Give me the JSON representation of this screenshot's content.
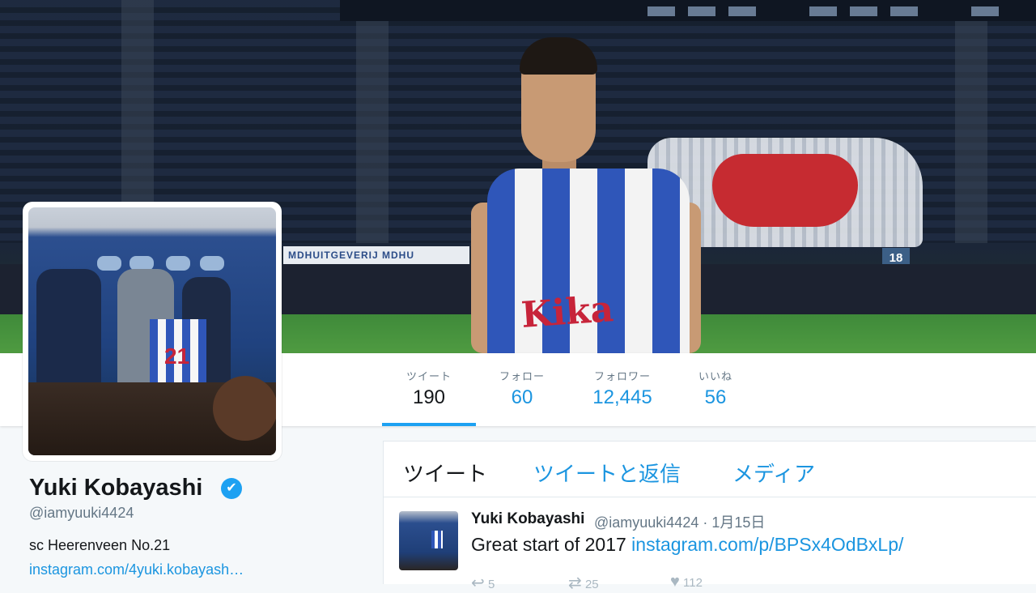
{
  "profile": {
    "name": "Yuki Kobayashi",
    "handle": "@iamyuuki4424",
    "bio": "sc Heerenveen No.21",
    "link": "instagram.com/4yuki.kobayash…",
    "verified_mark": "✔",
    "jersey_number": "21"
  },
  "banner": {
    "adboard_text": "MDHUITGEVERIJ   MDHU",
    "sign_number": "18",
    "shirt_sponsor": "Kika"
  },
  "stats": [
    {
      "label": "ツイート",
      "value": "190"
    },
    {
      "label": "フォロー",
      "value": "60"
    },
    {
      "label": "フォロワー",
      "value": "12,445"
    },
    {
      "label": "いいね",
      "value": "56"
    }
  ],
  "tabs": [
    {
      "label": "ツイート"
    },
    {
      "label": "ツイートと返信"
    },
    {
      "label": "メディア"
    }
  ],
  "tweet": {
    "author": "Yuki Kobayashi",
    "meta": "@iamyuuki4424 · 1月15日",
    "text": "Great start of 2017 ",
    "link": "instagram.com/p/BPSx4OdBxLp/",
    "reply_count": "5",
    "retweet_count": "25",
    "like_count": "112",
    "reply_icon": "↩",
    "retweet_icon": "⇄",
    "like_icon": "♥"
  },
  "colors": {
    "accent": "#1da1f2",
    "link": "#1b95e0",
    "muted": "#657786"
  }
}
